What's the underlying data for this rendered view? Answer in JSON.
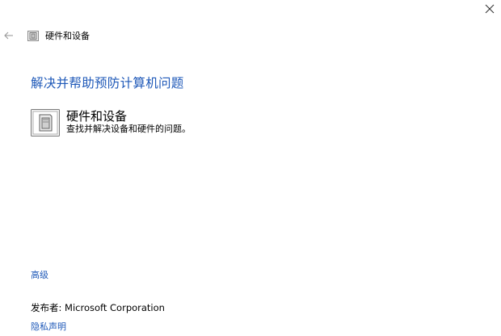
{
  "window": {
    "close_icon": "close-icon"
  },
  "nav": {
    "back_icon": "back-arrow-icon",
    "breadcrumb_icon": "hardware-devices-icon",
    "breadcrumb_title": "硬件和设备"
  },
  "main": {
    "heading": "解决并帮助预防计算机问题",
    "troubleshooter": {
      "icon": "hardware-devices-icon",
      "title": "硬件和设备",
      "description": "查找并解决设备和硬件的问题。"
    }
  },
  "footer": {
    "advanced_label": "高级",
    "publisher_label": "发布者:",
    "publisher_value": "Microsoft Corporation",
    "privacy_label": "隐私声明"
  },
  "colors": {
    "link": "#1e58b8",
    "background": "#ffffff",
    "text": "#000000"
  }
}
